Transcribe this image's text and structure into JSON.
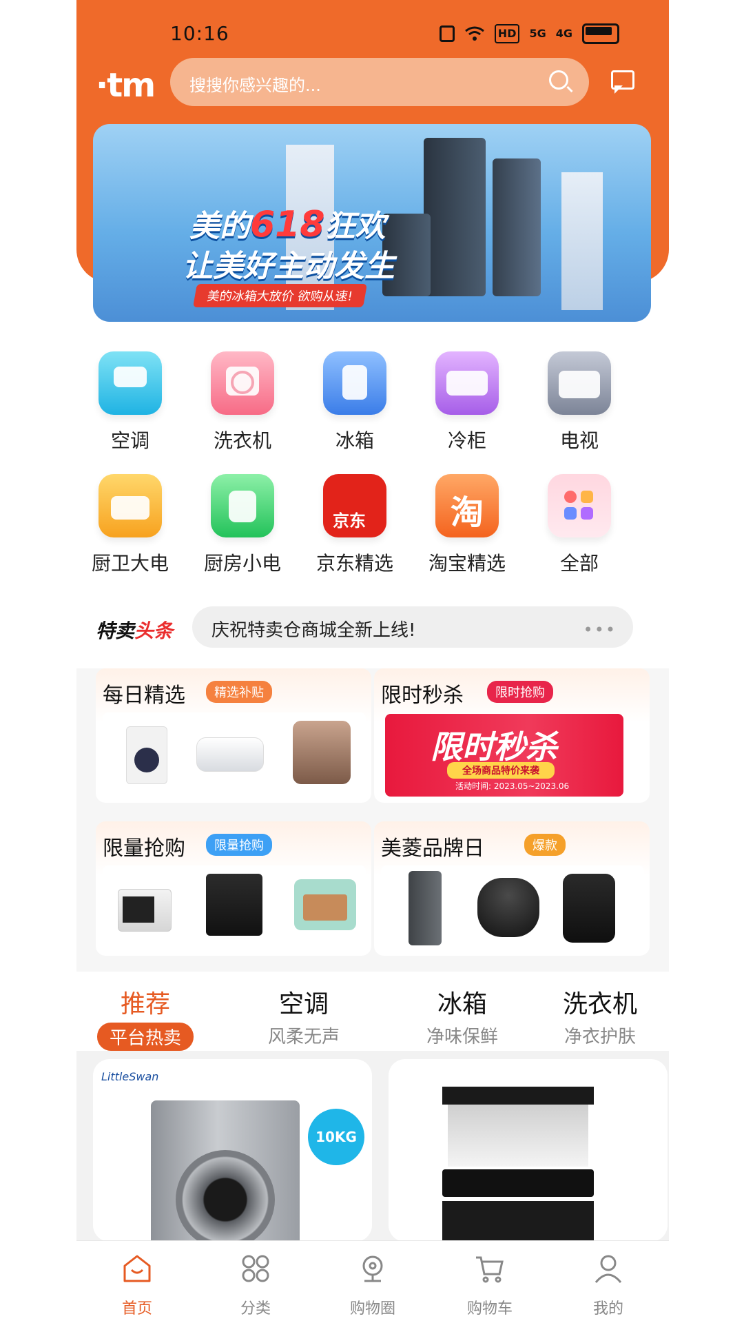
{
  "status": {
    "time": "10:16",
    "icons": [
      "nfc-icon",
      "wifi-icon",
      "hd-icon",
      "5g-icon",
      "4g-icon",
      "battery-icon"
    ],
    "labels": {
      "hd": "HD",
      "g5": "5G",
      "g4": "4G"
    }
  },
  "header": {
    "logo": "·tm",
    "search_placeholder": "搜搜你感兴趣的...",
    "accent": "#ef6a2a"
  },
  "banner": {
    "line1_pre": "美的",
    "line1_num": "618",
    "line1_post": "狂欢",
    "line2": "让美好主动发生",
    "line3": "美的冰箱大放价 欲购从速!"
  },
  "categories": [
    {
      "label": "空调",
      "icon": "air-conditioner-icon"
    },
    {
      "label": "洗衣机",
      "icon": "washing-machine-icon"
    },
    {
      "label": "冰箱",
      "icon": "refrigerator-icon"
    },
    {
      "label": "冷柜",
      "icon": "freezer-icon"
    },
    {
      "label": "电视",
      "icon": "tv-icon"
    },
    {
      "label": "厨卫大电",
      "icon": "range-hood-icon"
    },
    {
      "label": "厨房小电",
      "icon": "kettle-icon"
    },
    {
      "label": "京东精选",
      "icon": "jd-icon",
      "mark": "京东"
    },
    {
      "label": "淘宝精选",
      "icon": "taobao-icon",
      "mark": "淘"
    },
    {
      "label": "全部",
      "icon": "all-icon"
    }
  ],
  "news": {
    "tag_a": "特卖",
    "tag_b": "头条",
    "text": "庆祝特卖仓商城全新上线!",
    "more": "•••"
  },
  "promo": [
    {
      "title": "每日精选",
      "badge": "精选补贴"
    },
    {
      "title": "限时秒杀",
      "badge": "限时抢购",
      "flash_title": "限时秒杀",
      "flash_sub": "全场商品特价来袭",
      "flash_date": "活动时间: 2023.05~2023.06"
    },
    {
      "title": "限量抢购",
      "badge": "限量抢购"
    },
    {
      "title": "美菱品牌日",
      "badge": "爆款"
    }
  ],
  "tabs": [
    {
      "title": "推荐",
      "sub": "平台热卖"
    },
    {
      "title": "空调",
      "sub": "风柔无声"
    },
    {
      "title": "冰箱",
      "sub": "净味保鲜"
    },
    {
      "title": "洗衣机",
      "sub": "净衣护肤"
    }
  ],
  "products": [
    {
      "brand": "LittleSwan",
      "badge": "10KG"
    },
    {
      "brand": ""
    }
  ],
  "nav": [
    {
      "label": "首页",
      "icon": "home-icon"
    },
    {
      "label": "分类",
      "icon": "category-icon"
    },
    {
      "label": "购物圈",
      "icon": "location-icon"
    },
    {
      "label": "购物车",
      "icon": "cart-icon"
    },
    {
      "label": "我的",
      "icon": "user-icon"
    }
  ]
}
